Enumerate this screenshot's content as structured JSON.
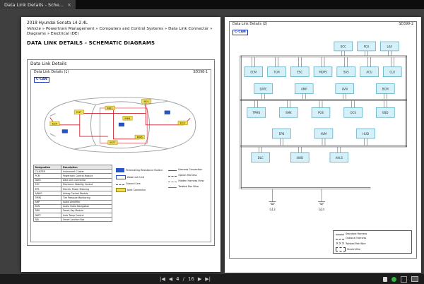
{
  "colors": {
    "accent_blue": "#2038b0",
    "harness_red": "#cf2030",
    "connector_yellow": "#f2df4e",
    "module_cyan": "#d6f0f9",
    "status_green": "#35b24a"
  },
  "tab": {
    "title": "Data Link Details - Sche...",
    "close_label": "×"
  },
  "header": {
    "vehicle": "2018 Hyundai Sonata L4-2.4L",
    "breadcrumb": "Vehicle » Powertrain Management » Computers and Control Systems » Data Link Connector » Diagrams » Electrical (DE)",
    "title": "DATA LINK DETAILS - SCHEMATIC DIAGRAMS"
  },
  "page1": {
    "section_label": "Data Link Details",
    "diagram_label": "Data Link Details (1)",
    "code": "SD398-1",
    "bus": "C-CAN",
    "connectors": [
      "E34",
      "E47",
      "M01",
      "M64",
      "M77",
      "M96",
      "R01",
      "D11"
    ],
    "legend_table": {
      "headers": [
        "Designation",
        "Description"
      ],
      "rows": [
        [
          "CLUSTER",
          "Instrument Cluster"
        ],
        [
          "PCM",
          "Powertrain Control Module"
        ],
        [
          "DATA",
          "Data Link Connector"
        ],
        [
          "ESC",
          "Electronic Stability Control"
        ],
        [
          "EPS",
          "Electric Power Steering"
        ],
        [
          "A/BAG",
          "Airbag Control Module"
        ],
        [
          "TPMS",
          "Tire Pressure Monitoring"
        ],
        [
          "AMP",
          "Audio Amplifier"
        ],
        [
          "AVN",
          "Audio Video Navigation"
        ],
        [
          "SMK",
          "Smart Key Module"
        ],
        [
          "DATC",
          "Auto Temp Control"
        ],
        [
          "SJB",
          "Smart Junction Box"
        ]
      ]
    },
    "legend_col_a": [
      {
        "icon": "box-blue-solid",
        "label": "Terminating Resistance Built-in"
      },
      {
        "icon": "box-blue-open",
        "label": "Data Link Unit"
      },
      {
        "icon": "dash-blue",
        "label": "Ground Line"
      },
      {
        "icon": "box-yellow",
        "label": "Joint Connector"
      }
    ],
    "legend_col_b": [
      {
        "icon": "line-red",
        "label": "Harness Connection"
      },
      {
        "icon": "dash-red",
        "label": "Option Harness"
      },
      {
        "icon": "dash-gray",
        "label": "Hidden Harness View"
      },
      {
        "icon": "line-gray",
        "label": "Twisted Pair Wire"
      }
    ]
  },
  "page2": {
    "diagram_label": "Data Link Details (2)",
    "code": "SD399-2",
    "bus": "C-CAN",
    "modules_rows": [
      [
        "SCC",
        "FCA",
        "LKA"
      ],
      [
        "ECM",
        "TCM",
        "ESC",
        "MDPS",
        "SAS",
        "ACU",
        "CLU"
      ],
      [
        "DATC",
        "AMP",
        "AVN",
        "BCM"
      ],
      [
        "TPMS",
        "SMK",
        "PGS",
        "OCS",
        "BSD"
      ],
      [
        "EPB",
        "AVM",
        "HUD"
      ],
      [
        "DLC",
        "4WD",
        "AHLS"
      ]
    ],
    "grounds": [
      "G13",
      "G24"
    ],
    "legend": [
      {
        "icon": "solid-line",
        "label": "Standard Harness"
      },
      {
        "icon": "dash-line",
        "label": "Optional Harness"
      },
      {
        "icon": "twist-line",
        "label": "Twisted Pair Wire"
      },
      {
        "icon": "shield-line",
        "label": "Shield Wire"
      }
    ]
  },
  "toolbar": {
    "first_icon": "|◀",
    "prev_icon": "◀",
    "current": "4",
    "separator": "/",
    "total": "16",
    "next_icon": "▶",
    "last_icon": "▶|"
  }
}
